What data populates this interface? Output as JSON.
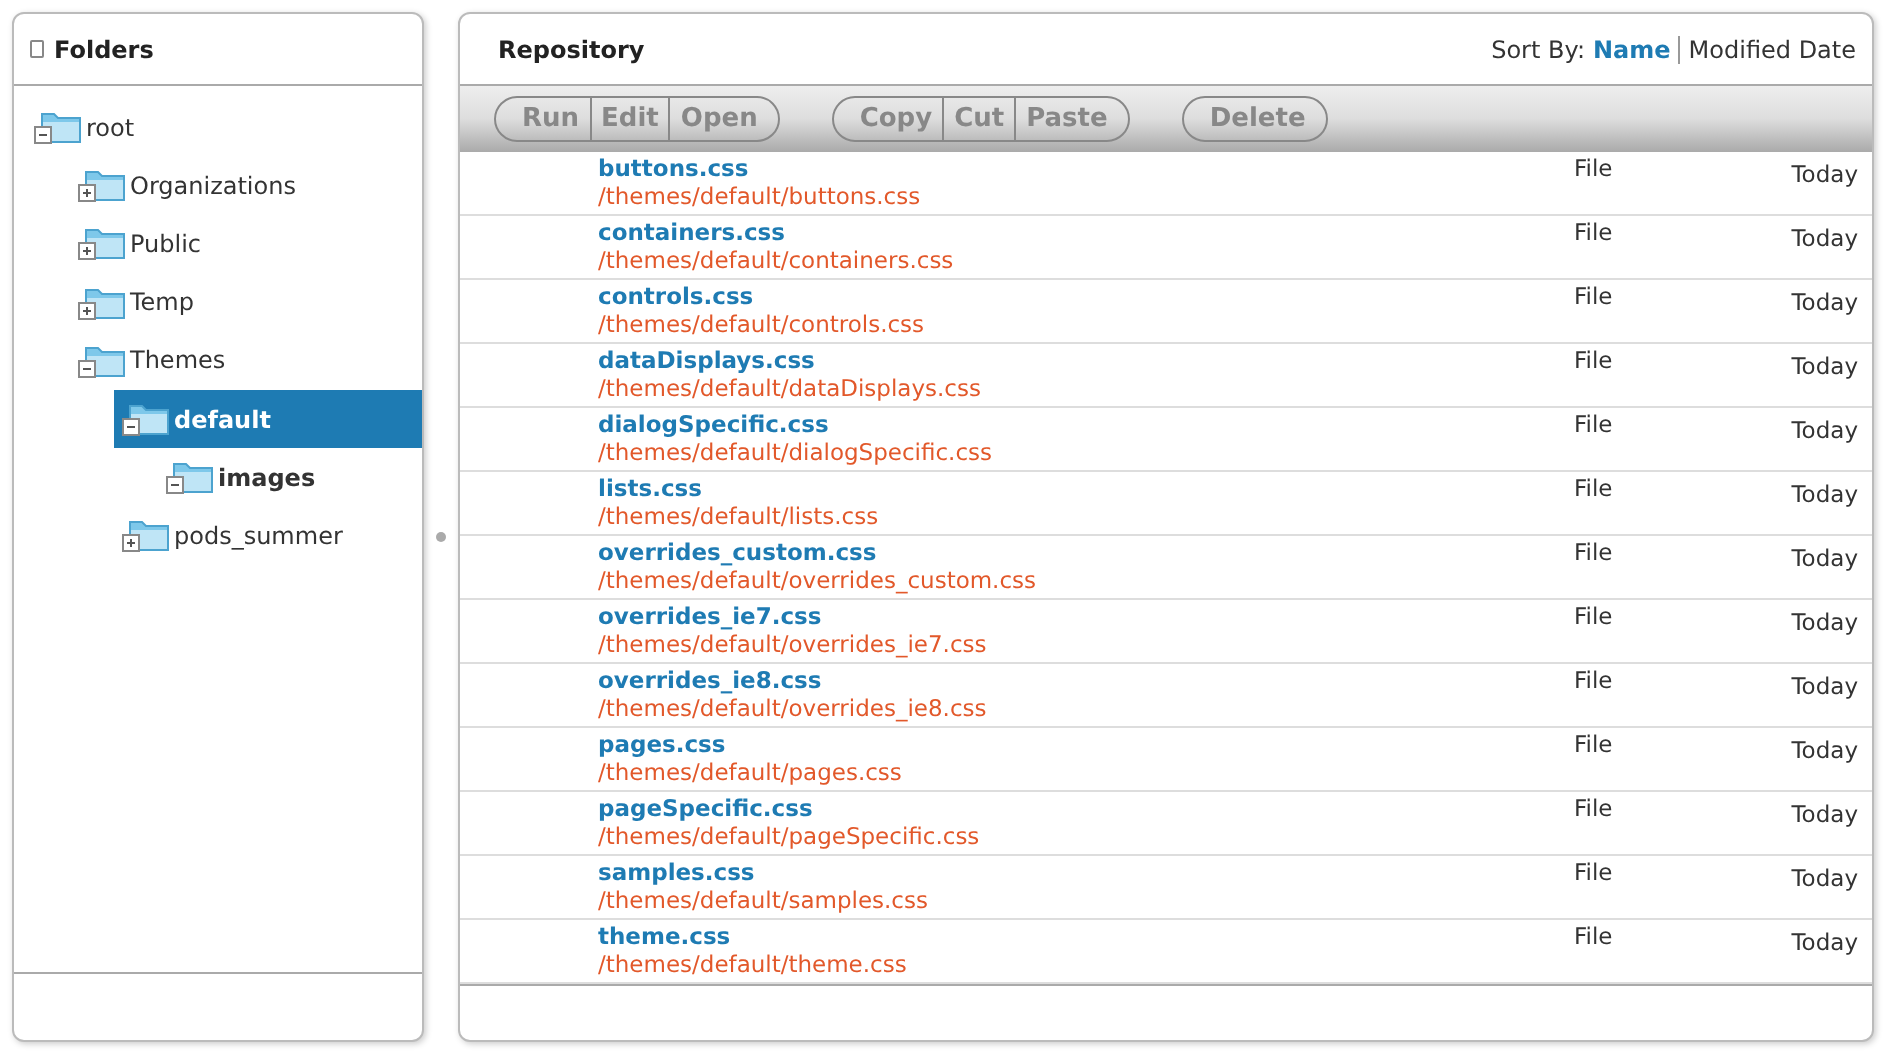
{
  "folders": {
    "title": "Folders",
    "tree": [
      {
        "label": "root",
        "expanded": true,
        "selected": false,
        "bold": false,
        "children": [
          {
            "label": "Organizations",
            "expanded": false,
            "selected": false,
            "bold": false
          },
          {
            "label": "Public",
            "expanded": false,
            "selected": false,
            "bold": false
          },
          {
            "label": "Temp",
            "expanded": false,
            "selected": false,
            "bold": false
          },
          {
            "label": "Themes",
            "expanded": true,
            "selected": false,
            "bold": false,
            "children": [
              {
                "label": "default",
                "expanded": true,
                "selected": true,
                "bold": true,
                "children": [
                  {
                    "label": "images",
                    "expanded": true,
                    "selected": false,
                    "bold": true
                  }
                ]
              },
              {
                "label": "pods_summer",
                "expanded": false,
                "selected": false,
                "bold": false
              }
            ]
          }
        ]
      }
    ]
  },
  "repository": {
    "title": "Repository",
    "sort_label": "Sort By:",
    "sort_options": [
      {
        "label": "Name",
        "selected": true
      },
      {
        "label": "Modified Date",
        "selected": false
      }
    ],
    "toolbar": [
      [
        {
          "label": "Run",
          "disabled": true
        },
        {
          "label": "Edit",
          "disabled": true
        },
        {
          "label": "Open",
          "disabled": true
        }
      ],
      [
        {
          "label": "Copy",
          "disabled": true
        },
        {
          "label": "Cut",
          "disabled": true
        },
        {
          "label": "Paste",
          "disabled": true
        }
      ],
      [
        {
          "label": "Delete",
          "disabled": true
        }
      ]
    ],
    "files": [
      {
        "name": "buttons.css",
        "path": "/themes/default/buttons.css",
        "type": "File",
        "date": "Today"
      },
      {
        "name": "containers.css",
        "path": "/themes/default/containers.css",
        "type": "File",
        "date": "Today"
      },
      {
        "name": "controls.css",
        "path": "/themes/default/controls.css",
        "type": "File",
        "date": "Today"
      },
      {
        "name": "dataDisplays.css",
        "path": "/themes/default/dataDisplays.css",
        "type": "File",
        "date": "Today"
      },
      {
        "name": "dialogSpecific.css",
        "path": "/themes/default/dialogSpecific.css",
        "type": "File",
        "date": "Today"
      },
      {
        "name": "lists.css",
        "path": "/themes/default/lists.css",
        "type": "File",
        "date": "Today"
      },
      {
        "name": "overrides_custom.css",
        "path": "/themes/default/overrides_custom.css",
        "type": "File",
        "date": "Today"
      },
      {
        "name": "overrides_ie7.css",
        "path": "/themes/default/overrides_ie7.css",
        "type": "File",
        "date": "Today"
      },
      {
        "name": "overrides_ie8.css",
        "path": "/themes/default/overrides_ie8.css",
        "type": "File",
        "date": "Today"
      },
      {
        "name": "pages.css",
        "path": "/themes/default/pages.css",
        "type": "File",
        "date": "Today"
      },
      {
        "name": "pageSpecific.css",
        "path": "/themes/default/pageSpecific.css",
        "type": "File",
        "date": "Today"
      },
      {
        "name": "samples.css",
        "path": "/themes/default/samples.css",
        "type": "File",
        "date": "Today"
      },
      {
        "name": "theme.css",
        "path": "/themes/default/theme.css",
        "type": "File",
        "date": "Today"
      }
    ]
  }
}
